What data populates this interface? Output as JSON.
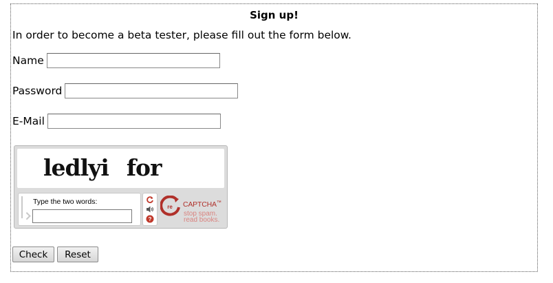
{
  "form": {
    "title": "Sign up!",
    "intro": "In order to become a beta tester, please fill out the form below.",
    "name_label": "Name",
    "name_value": "",
    "password_label": "Password",
    "password_value": "",
    "email_label": "E-Mail",
    "email_value": ""
  },
  "recaptcha": {
    "words": [
      "ledlyi",
      "for"
    ],
    "prompt": "Type the two words:",
    "response_value": "",
    "icons": [
      "refresh-icon",
      "audio-icon",
      "help-icon"
    ],
    "logo_prefix": "re",
    "logo_text": "CAPTCHA",
    "logo_tm": "™",
    "tagline_1": "stop spam.",
    "tagline_2": "read books.",
    "accent_color": "#b0302a"
  },
  "buttons": {
    "check_label": "Check",
    "reset_label": "Reset"
  }
}
